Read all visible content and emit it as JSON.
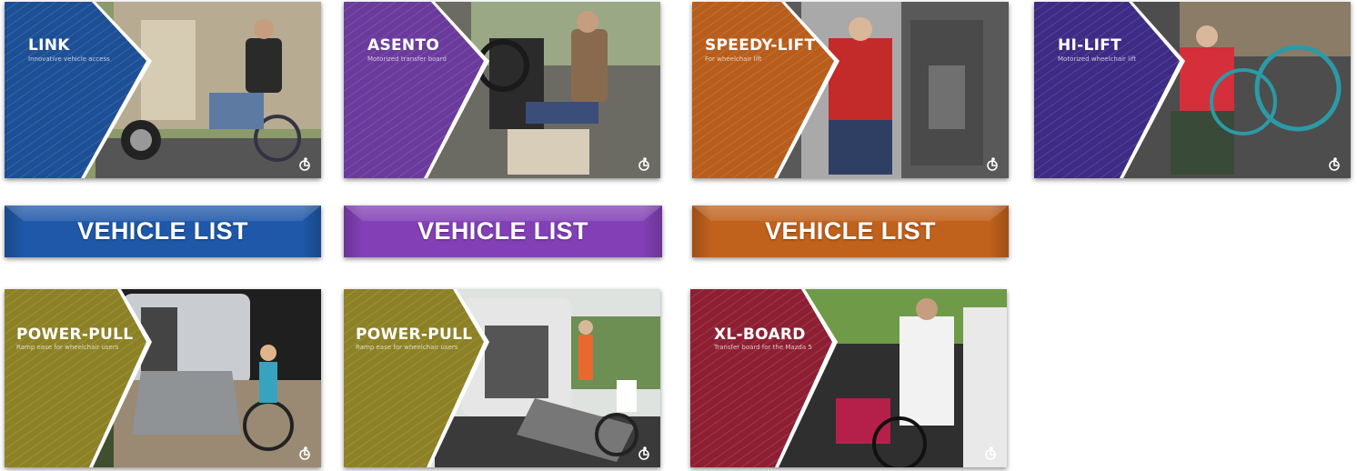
{
  "colors": {
    "blue": "#1d4f96",
    "purple": "#6a3a9c",
    "orange": "#b85d1b",
    "indigo": "#3d2b86",
    "olive": "#8d8125",
    "crimson": "#8e1f33"
  },
  "cards": [
    {
      "title": "LINK",
      "subtitle": "Innovative vehicle access",
      "color": "#1d4f96",
      "logo_icon": "wheelchair-logo-icon"
    },
    {
      "title": "ASENTO",
      "subtitle": "Motorized transfer board",
      "color": "#6a3a9c",
      "logo_icon": "wheelchair-logo-icon"
    },
    {
      "title": "SPEEDY-LIFT",
      "subtitle": "For wheelchair lift",
      "color": "#b85d1b",
      "logo_icon": "wheelchair-logo-icon"
    },
    {
      "title": "HI-LIFT",
      "subtitle": "Motorized wheelchair lift",
      "color": "#3d2b86",
      "logo_icon": "wheelchair-logo-icon"
    },
    {
      "title": "POWER-PULL",
      "subtitle": "Ramp ease for wheelchair users",
      "color": "#8d8125",
      "logo_icon": "wheelchair-logo-icon"
    },
    {
      "title": "POWER-PULL",
      "subtitle": "Ramp ease for wheelchair users",
      "color": "#8d8125",
      "logo_icon": "wheelchair-logo-icon"
    },
    {
      "title": "XL-BOARD",
      "subtitle": "Transfer board for the Mazda 5",
      "color": "#8e1f33",
      "logo_icon": "wheelchair-logo-icon"
    }
  ],
  "buttons": [
    {
      "label": "VEHICLE LIST",
      "color": "#1f58a8"
    },
    {
      "label": "VEHICLE LIST",
      "color": "#8340b6"
    },
    {
      "label": "VEHICLE LIST",
      "color": "#c0611c"
    }
  ]
}
